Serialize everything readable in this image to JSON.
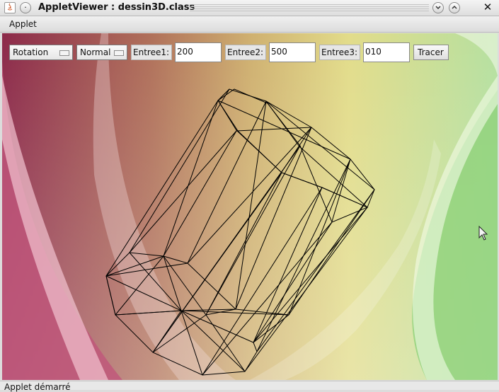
{
  "window": {
    "title": "AppletViewer : dessin3D.class"
  },
  "menu": {
    "items": [
      "Applet"
    ]
  },
  "controls": {
    "mode_choice": "Rotation",
    "style_choice": "Normal",
    "entree1_label": "Entree1:",
    "entree1_value": "200",
    "entree2_label": "Entree2:",
    "entree2_value": "500",
    "entree3_label": "Entree3:",
    "entree3_value": "010",
    "draw_button": "Tracer"
  },
  "status": {
    "text": "Applet démarré"
  },
  "icons": [
    "java-icon",
    "window-menu-icon",
    "minimize-icon",
    "maximize-icon",
    "close-icon",
    "mouse-pointer-icon",
    "dropdown-arrow-icon"
  ]
}
